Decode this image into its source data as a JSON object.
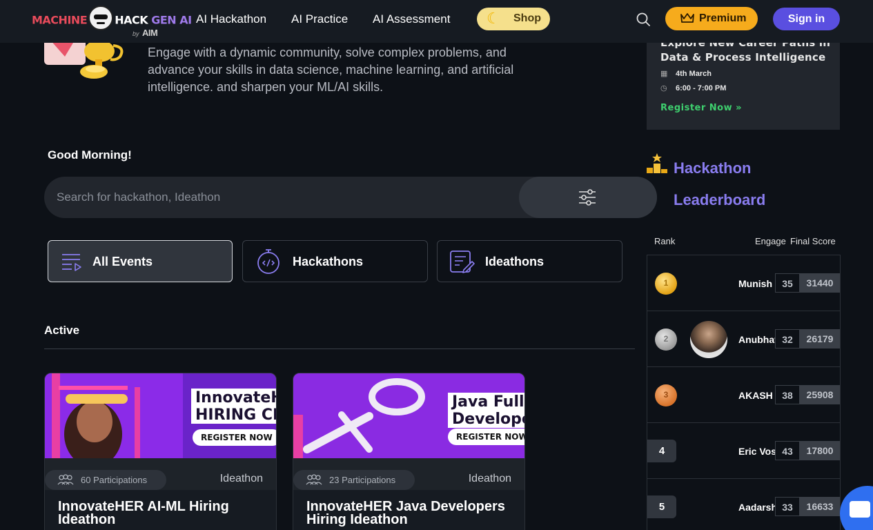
{
  "nav": {
    "logo": {
      "machine": "MACHINE",
      "hack": "HACK",
      "genai": "GEN AI",
      "by": "by",
      "aim": "AIM"
    },
    "links": [
      "AI Hackathon",
      "AI Practice",
      "AI Assessment"
    ],
    "shop_label": "Shop",
    "premium_label": "Premium",
    "signin_label": "Sign in"
  },
  "hero": {
    "description": "Engage with a dynamic community, solve complex problems, and advance your skills in data science, machine learning, and artificial intelligence. and sharpen your ML/AI skills."
  },
  "event_card": {
    "title": "Explore New Career Paths in Data & Process Intelligence",
    "date": "4th March",
    "time": "6:00 - 7:00 PM",
    "register_label": "Register Now"
  },
  "greeting": "Good Morning!",
  "search": {
    "placeholder": "Search for hackathon, Ideathon"
  },
  "tabs": [
    {
      "label": "All Events",
      "active": true
    },
    {
      "label": "Hackathons",
      "active": false
    },
    {
      "label": "Ideathons",
      "active": false
    }
  ],
  "active_section": {
    "heading": "Active",
    "cards": [
      {
        "participations": "60 Participations",
        "type": "Ideathon",
        "title": "InnovateHER AI-ML Hiring Ideathon",
        "banner_line1": "InnovateH",
        "banner_line2": "HIRING CH",
        "banner_register": "REGISTER NOW"
      },
      {
        "participations": "23 Participations",
        "type": "Ideathon",
        "title": "InnovateHER Java Developers Hiring Ideathon",
        "banner_line1": "Java Full",
        "banner_line2": "Develope",
        "banner_register": "REGISTER NOW"
      }
    ]
  },
  "leaderboard": {
    "title_line1": "Hackathon",
    "title_line2": "Leaderboard",
    "columns": {
      "rank": "Rank",
      "engage": "Engage",
      "score": "Final Score"
    },
    "rows": [
      {
        "rank": "1",
        "name": "Munish",
        "engage": "35",
        "score": "31440"
      },
      {
        "rank": "2",
        "name": "Anubhav Tyagi",
        "engage": "32",
        "score": "26179"
      },
      {
        "rank": "3",
        "name": "AKASH GUPTA",
        "engage": "38",
        "score": "25908"
      },
      {
        "rank": "4",
        "name": "Eric Vos",
        "engage": "43",
        "score": "17800"
      },
      {
        "rank": "5",
        "name": "Aadarsh Singh",
        "engage": "33",
        "score": "16633"
      }
    ]
  },
  "colors": {
    "background": "#0d1117",
    "nav": "#161b22",
    "shop": "#f5e08c",
    "premium": "#f6ab1c",
    "signin": "#5a4fe0",
    "leaderboard_title": "#8a7df0",
    "register_green": "#3ecf6e"
  }
}
